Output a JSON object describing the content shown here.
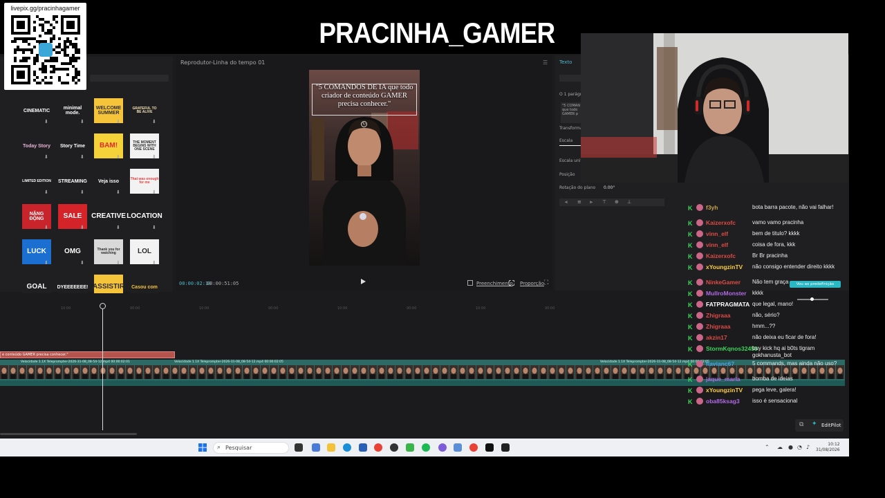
{
  "stream": {
    "title": "PRACINHA_GAMER",
    "qr_url": "livepix.gg/pracinhagamer"
  },
  "stickers": [
    {
      "text": "CINEMATIC",
      "color": "#ffffff",
      "bg": "#1f1f21"
    },
    {
      "text": "minimal mode.",
      "color": "#ffffff",
      "bg": "#1f1f21"
    },
    {
      "text": "WELCOME SUMMER",
      "color": "#2b2b2b",
      "bg": "#f6c43a"
    },
    {
      "text": "GRATEFUL TO BE ALIVE",
      "color": "#f2e2b6",
      "bg": "#1f1f21"
    },
    {
      "text": "Today Story",
      "color": "#e9b4d9",
      "bg": "#1f1f21"
    },
    {
      "text": "Story Time",
      "color": "#ffffff",
      "bg": "#1f1f21"
    },
    {
      "text": "BAM!",
      "color": "#e3272b",
      "bg": "#f6d23a"
    },
    {
      "text": "THE MOMENT BEGINS WITH ONE SCENE",
      "color": "#2b2b2b",
      "bg": "#f2f2f2"
    },
    {
      "text": "LIMITED EDITION",
      "color": "#ffffff",
      "bg": "#1f1f21"
    },
    {
      "text": "STREAMING",
      "color": "#ffffff",
      "bg": "#1f1f21"
    },
    {
      "text": "Veja isso",
      "color": "#ffffff",
      "bg": "#1f1f21"
    },
    {
      "text": "That was enough for me",
      "color": "#e63b3b",
      "bg": "#f2f2f2"
    },
    {
      "text": "NĂNG ĐỘNG",
      "color": "#ffffff",
      "bg": "#c9242c"
    },
    {
      "text": "SALE",
      "color": "#ffffff",
      "bg": "#d4242a"
    },
    {
      "text": "CREATIVE",
      "color": "#ffffff",
      "bg": "#1f1f21"
    },
    {
      "text": "LOCATION",
      "color": "#ffffff",
      "bg": "#1f1f21"
    },
    {
      "text": "LUCK",
      "color": "#ffffff",
      "bg": "#1a6fd1"
    },
    {
      "text": "OMG",
      "color": "#ffffff",
      "bg": "#1f1f21"
    },
    {
      "text": "Thank you for watching",
      "color": "#2b2b2b",
      "bg": "#d9d9d9"
    },
    {
      "text": "LOL",
      "color": "#2b2b2b",
      "bg": "#f2f2f2"
    },
    {
      "text": "GOAL",
      "color": "#ffffff",
      "bg": "#1f1f21"
    },
    {
      "text": "DYEEEEEEE!",
      "color": "#ffffff",
      "bg": "#1f1f21"
    },
    {
      "text": "ASSISTIR",
      "color": "#2b2b2b",
      "bg": "#f6c43a"
    },
    {
      "text": "Casou com",
      "color": "#f6c43a",
      "bg": "#1f1f21"
    }
  ],
  "player": {
    "title": "Reprodutor-Linha do tempo 01",
    "overlay_text": "\"5 COMANDOS DE IA que todo criador de conteúdo GAMER precisa conhecer.\"",
    "time_current": "00:00:02:18",
    "time_total": "00:00:51:05",
    "btn_full": "Preenchimento",
    "btn_ratio": "Proporção"
  },
  "properties": {
    "tab_text": "Texto",
    "label_paragraph": "O 1 parágrafo",
    "preview_text": "\"5 COMAN que todo GAMER p",
    "label_transform": "Transformar",
    "label_scale": "Escala",
    "label_uniform": "Escala uniforme",
    "label_position": "Posição",
    "label_rotation": "Rotação do plano",
    "rotation_value": "0.00°"
  },
  "timeline": {
    "text_clip": "e conteúdo GAMER precisa conhecer.\"",
    "clip_labels": [
      "Velocidade 1.1X   Teleprompter-2026-31-08_08-54-12.mp4   00:00:02:01",
      "Velocidade 1.1X   Teleprompter-2026-31-08_08-54-12.mp4   00:00:02:05",
      "Velocidade 1.1X   Teleprompter-2026-31-08_08-54-12.mp4   00:00:02:05"
    ]
  },
  "chat": [
    {
      "user": "f3yh",
      "color": "#c8a14a",
      "msg": "bota barra pacote, não vai falhar!"
    },
    {
      "user": "Kaizerxofc",
      "color": "#e04a44",
      "msg": "vamo vamo pracinha"
    },
    {
      "user": "vinn_elf",
      "color": "#e04a44",
      "msg": "bem de titulo? kkkk"
    },
    {
      "user": "vinn_elf",
      "color": "#e04a44",
      "msg": "coisa de fora, kkk"
    },
    {
      "user": "Kaizerxofc",
      "color": "#e04a44",
      "msg": "Br Br pracinha"
    },
    {
      "user": "xYoungzinTV",
      "color": "#ffd03a",
      "msg": "não consigo entender direito kkkk"
    },
    {
      "user": "NinkeGamer",
      "color": "#e04a44",
      "msg": "Não tem graça"
    },
    {
      "user": "MulIroMonster",
      "color": "#b06ae6",
      "msg": "kkkk"
    },
    {
      "user": "FATPRAGMATA",
      "color": "#ffffff",
      "msg": "que legal, mano!"
    },
    {
      "user": "Zhigraaa",
      "color": "#e04a44",
      "msg": "não, sério?"
    },
    {
      "user": "Zhigraaa",
      "color": "#e04a44",
      "msg": "hmm...??"
    },
    {
      "user": "akzin17",
      "color": "#e04a44",
      "msg": "não deixa eu ficar de fora!"
    },
    {
      "user": "StormKqnos32450",
      "color": "#39d65a",
      "msg": "buy kick hq ai b0ts tigram gokhanusta_bot"
    },
    {
      "user": "flavianc67",
      "color": "#4aa3e6",
      "msg": "5 commands, mas ainda não uso?"
    },
    {
      "user": "jaque_maria",
      "color": "#b06ae6",
      "msg": "bomba de ideias"
    },
    {
      "user": "xYoungzinTV",
      "color": "#ffd03a",
      "msg": "pega leve, galera!"
    },
    {
      "user": "oba85ksag3",
      "color": "#b06ae6",
      "msg": "isso é sensacional"
    }
  ],
  "chat_overlay": {
    "pill": "Vou ao predefinição",
    "edit_pilot": "EditPilot"
  },
  "taskbar": {
    "search_placeholder": "Pesquisar",
    "time": "10:12",
    "date": "31/08/2026"
  }
}
